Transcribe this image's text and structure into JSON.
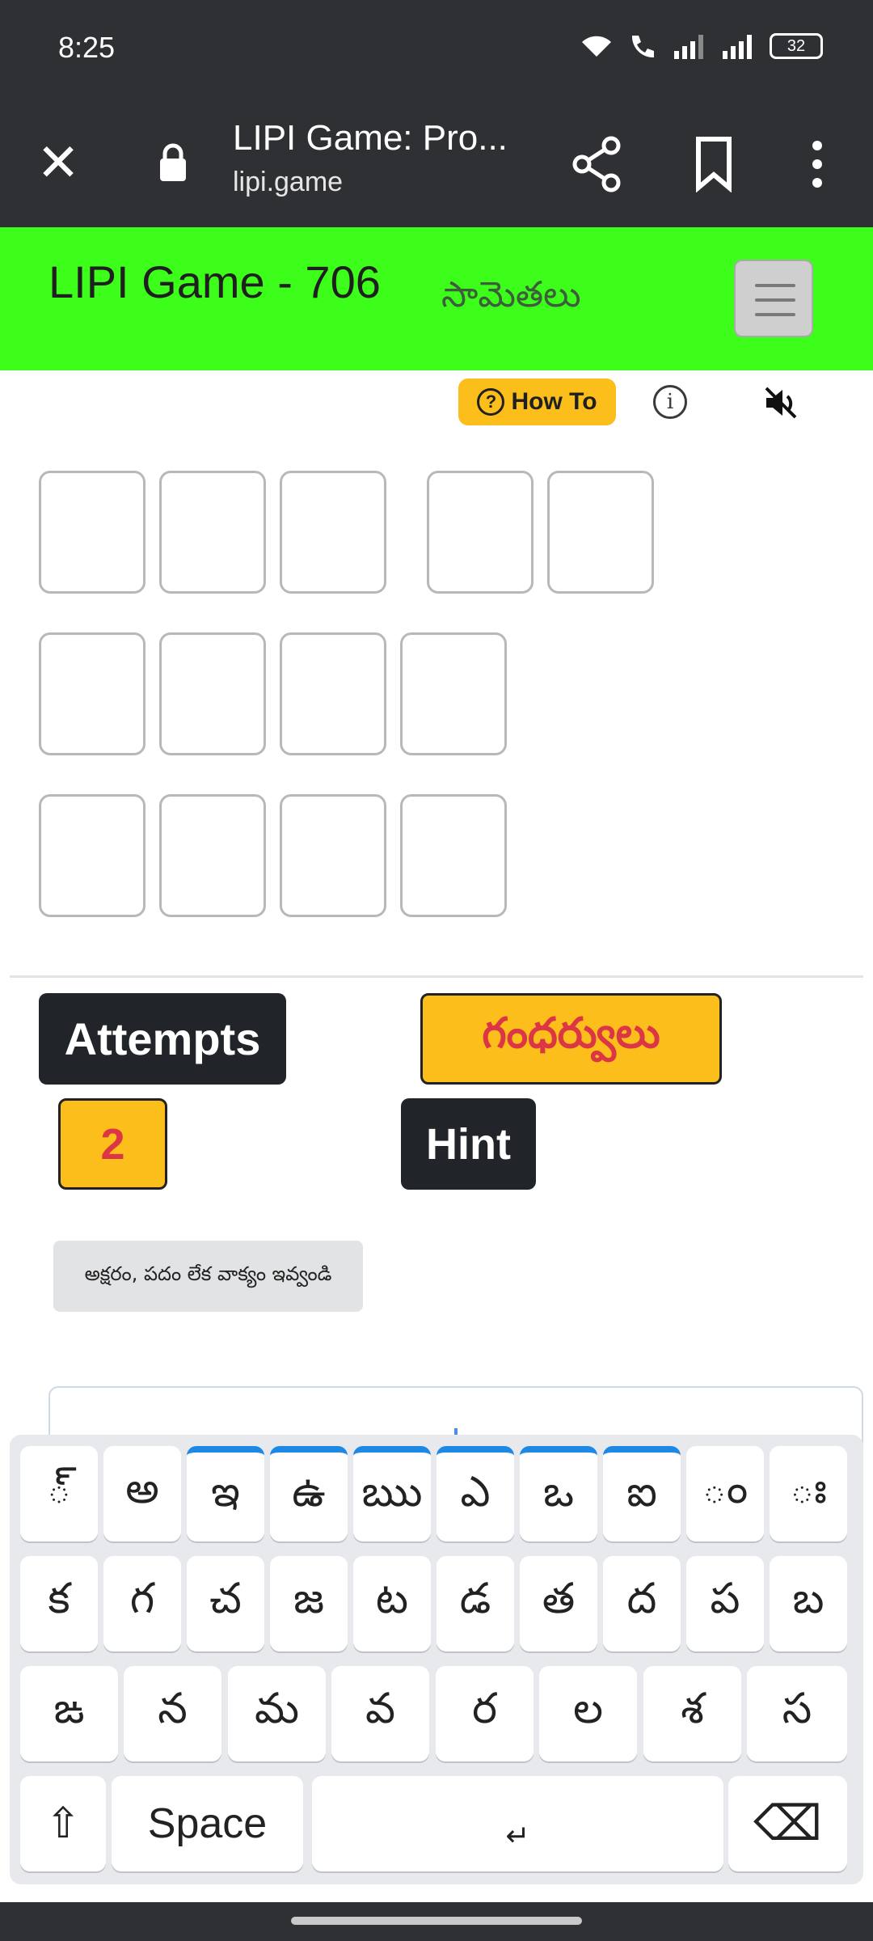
{
  "status_bar": {
    "time": "8:25",
    "battery": "32"
  },
  "browser": {
    "page_title": "LIPI Game: Pro...",
    "url": "lipi.game"
  },
  "header": {
    "title": "LIPI Game - 706",
    "category": "సామెతలు"
  },
  "controls": {
    "how_to": "How To",
    "how_to_icon": "?",
    "info_icon": "i"
  },
  "panel": {
    "attempts_label": "Attempts",
    "answer_word": "గంధర్వులు",
    "attempts_count": "2",
    "hint_label": "Hint",
    "input_hint": "అక్షరం, పదం లేక వాక్యం ఇవ్వండి"
  },
  "keyboard": {
    "row1": [
      "్",
      "అ",
      "ఇ",
      "ఉ",
      "ఋ",
      "ఎ",
      "ఒ",
      "ఐ",
      "ం",
      "ః"
    ],
    "row2": [
      "క",
      "గ",
      "చ",
      "జ",
      "ట",
      "డ",
      "త",
      "ద",
      "ప",
      "బ"
    ],
    "row3": [
      "ఙ",
      "న",
      "మ",
      "వ",
      "ర",
      "ల",
      "శ",
      "స"
    ],
    "shift": "⇧",
    "space": "Space",
    "enter": "↵",
    "backspace": "⌫"
  }
}
